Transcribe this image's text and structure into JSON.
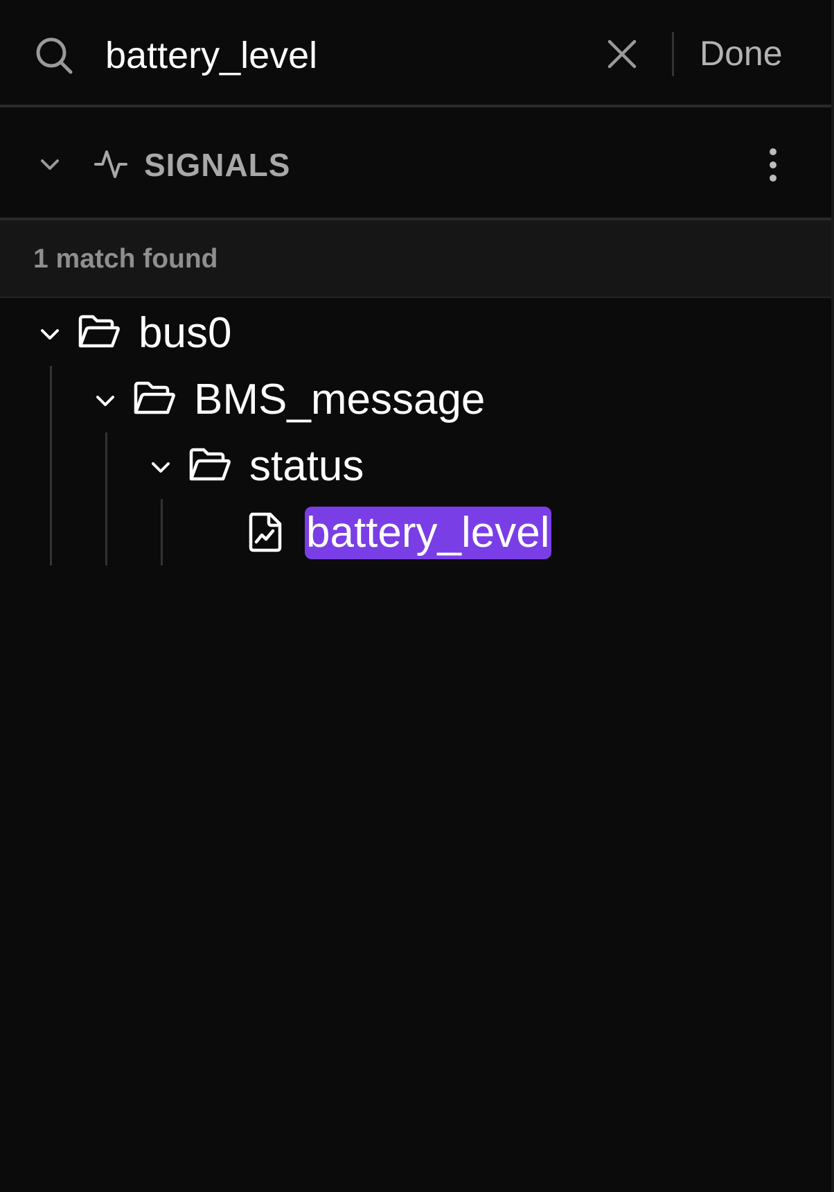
{
  "search": {
    "value": "battery_level",
    "done_label": "Done"
  },
  "section": {
    "title": "SIGNALS"
  },
  "results": {
    "match_text": "1 match found"
  },
  "tree": {
    "nodes": [
      {
        "label": "bus0",
        "type": "folder",
        "expanded": true
      },
      {
        "label": "BMS_message",
        "type": "folder",
        "expanded": true
      },
      {
        "label": "status",
        "type": "folder",
        "expanded": true
      },
      {
        "label": "battery_level",
        "type": "signal",
        "highlighted": true
      }
    ]
  },
  "colors": {
    "highlight": "#7a3ee6",
    "background": "#0b0b0b"
  }
}
